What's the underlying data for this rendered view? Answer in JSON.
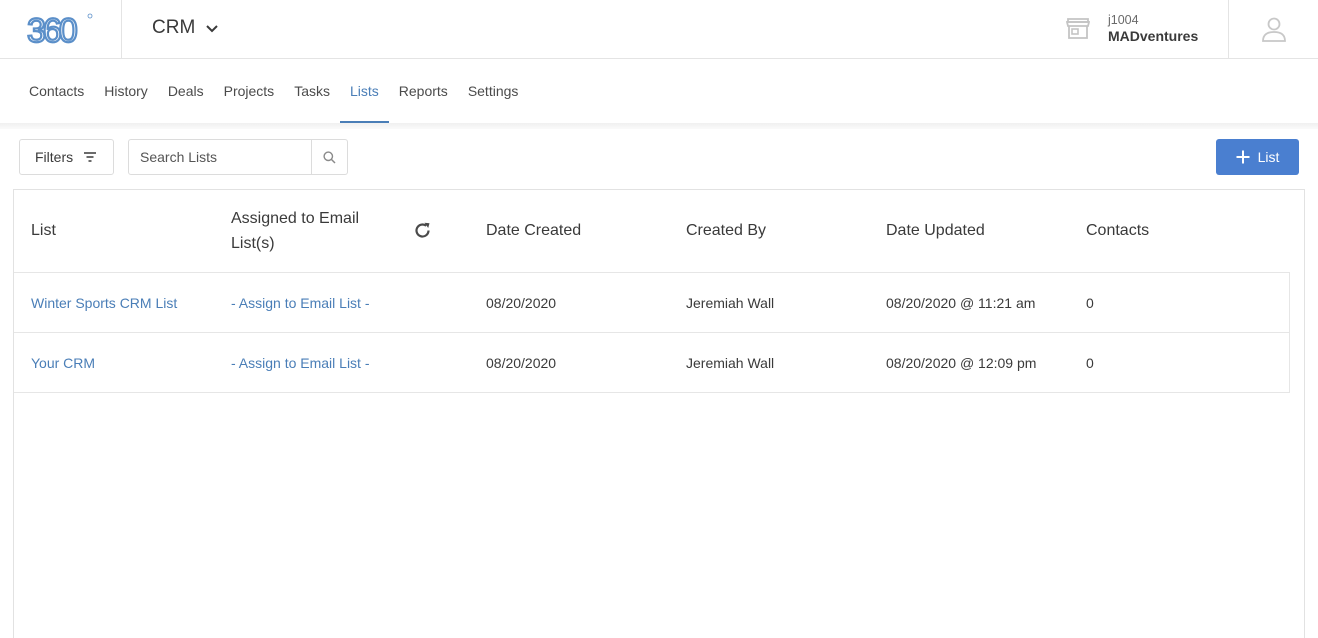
{
  "header": {
    "logo_alt": "360",
    "app_name": "CRM",
    "account_id": "j1004",
    "account_name": "MADventures"
  },
  "nav": {
    "tabs": [
      {
        "label": "Contacts",
        "active": false
      },
      {
        "label": "History",
        "active": false
      },
      {
        "label": "Deals",
        "active": false
      },
      {
        "label": "Projects",
        "active": false
      },
      {
        "label": "Tasks",
        "active": false
      },
      {
        "label": "Lists",
        "active": true
      },
      {
        "label": "Reports",
        "active": false
      },
      {
        "label": "Settings",
        "active": false
      }
    ]
  },
  "toolbar": {
    "filters_label": "Filters",
    "search_placeholder": "Search Lists",
    "add_button_label": "List"
  },
  "table": {
    "columns": [
      "List",
      "Assigned to Email List(s)",
      "Date Created",
      "Created By",
      "Date Updated",
      "Contacts"
    ],
    "rows": [
      {
        "list": "Winter Sports CRM List",
        "assigned": "- Assign to Email List -",
        "date_created": "08/20/2020",
        "created_by": "Jeremiah Wall",
        "date_updated": "08/20/2020 @ 11:21 am",
        "contacts": "0"
      },
      {
        "list": "Your CRM",
        "assigned": "- Assign to Email List -",
        "date_created": "08/20/2020",
        "created_by": "Jeremiah Wall",
        "date_updated": "08/20/2020 @ 12:09 pm",
        "contacts": "0"
      }
    ]
  },
  "colors": {
    "accent": "#4a7eb7",
    "button": "#4a7fd0",
    "logo": "#5b8fc9"
  },
  "icons": [
    "chevron-down-icon",
    "store-icon",
    "user-icon",
    "filter-icon",
    "search-icon",
    "plus-icon",
    "refresh-icon"
  ]
}
